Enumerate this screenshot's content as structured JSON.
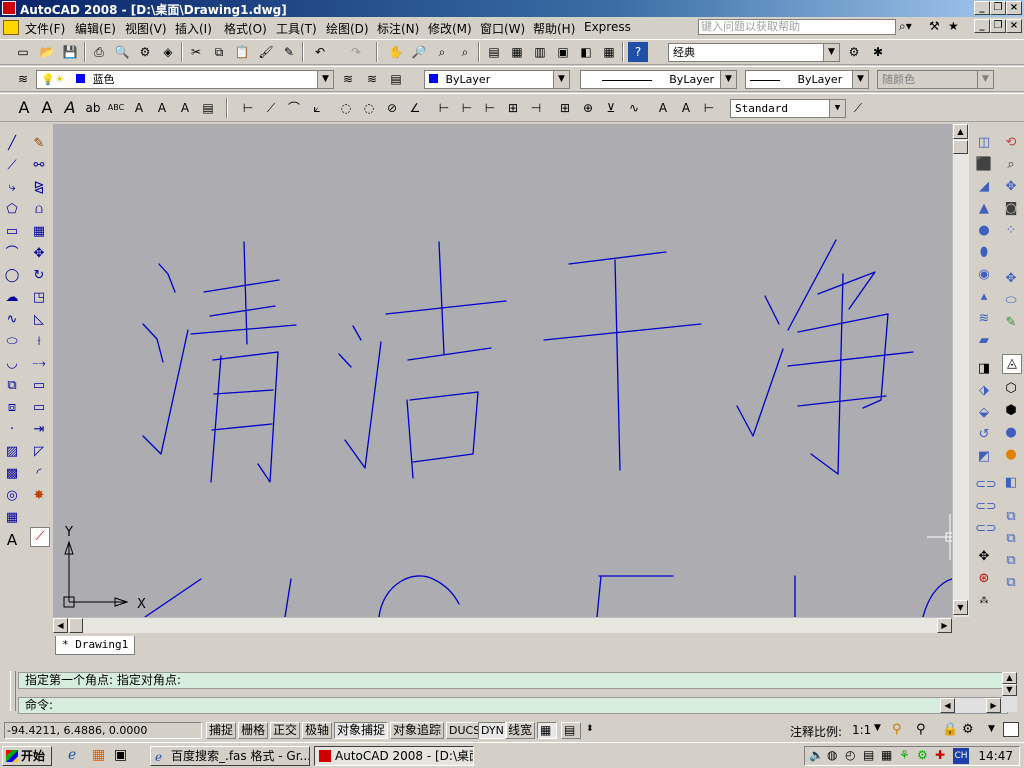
{
  "window": {
    "title": "AutoCAD 2008 - [D:\\桌面\\Drawing1.dwg]"
  },
  "menu": {
    "items": [
      "文件(F)",
      "编辑(E)",
      "视图(V)",
      "插入(I)",
      "格式(O)",
      "工具(T)",
      "绘图(D)",
      "标注(N)",
      "修改(M)",
      "窗口(W)",
      "帮助(H)",
      "Express"
    ],
    "help_placeholder": "键入问题以获取帮助"
  },
  "toolbars": {
    "workspace": "经典",
    "layer": "蓝色",
    "color": "ByLayer",
    "linetype": "ByLayer",
    "lineweight": "ByLayer",
    "plotstyle": "随颜色",
    "textstyle": "Standard"
  },
  "drawing": {
    "ucs_y": "Y",
    "ucs_x": "X",
    "stroke_color": "#0000cc",
    "canvas_color": "#adacb0"
  },
  "layout_tab": "* Drawing1",
  "command": {
    "line1": "指定第一个角点: 指定对角点:",
    "line2": "命令:"
  },
  "status": {
    "coords": "-94.4211, 6.4886, 0.0000",
    "buttons": [
      "捕捉",
      "栅格",
      "正交",
      "极轴",
      "对象捕捉",
      "对象追踪",
      "DUCS",
      "DYN",
      "线宽"
    ],
    "scale_label": "注释比例:",
    "scale_value": "1:1"
  },
  "taskbar": {
    "start": "开始",
    "task1": "百度搜索_.fas 格式 - Gr...",
    "task2": "AutoCAD 2008 - [D:\\桌面...",
    "clock": "14:47",
    "ime": "CH"
  }
}
